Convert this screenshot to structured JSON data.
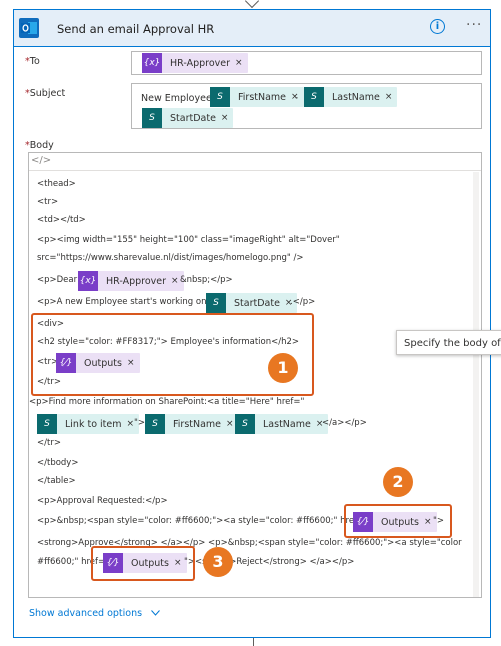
{
  "header": {
    "title": "Send an email Approval HR",
    "info_icon": "info-icon",
    "more_icon": "more-icon",
    "more_glyph": "···",
    "info_glyph": "i"
  },
  "fields": {
    "to_label": "To",
    "subject_label": "Subject",
    "body_label": "Body",
    "required_mark": "*"
  },
  "tokens": {
    "hr_approver": "HR-Approver",
    "first_name": "FirstName",
    "last_name": "LastName",
    "start_date": "StartDate",
    "link_to_item": "Link to item",
    "outputs": "Outputs",
    "remove": "×",
    "expr_icon": "{x}",
    "outputs_icon": "{⁄}"
  },
  "subject_text": {
    "prefix": "New Employee",
    "dash": "-"
  },
  "body": {
    "code_toggle": "</>",
    "lines": {
      "l1": "<thead>",
      "l2": "<tr>",
      "l3": "<td></td>",
      "l4": "<p><img width=\"155\" height=\"100\" class=\"imageRight\" alt=\"Dover\"",
      "l5": "src=\"https://www.sharevalue.nl/dist/images/homelogo.png\" />",
      "l6a": "<p>Dear",
      "l6b": "&nbsp;</p>",
      "l7a": "<p>A new Employee start's working on",
      "l7b": ".</p>",
      "l8": "<div>",
      "l9": "<h2 style=\"color: #FF8317;\"> Employee's information</h2>",
      "l10": "<tr>",
      "l11": "</tr>",
      "l12": "<p>Find more information on SharePoint:<a title=\"Here\" href=\"",
      "l13a": "\">",
      "l13b": "</a></p>",
      "l14": "</tr>",
      "l15": "</tbody>",
      "l16": "</table>",
      "l17": "<p>Approval Requested:</p>",
      "l18a": "<p>&nbsp;<span style=\"color: #ff6600;\"><a style=\"color: #ff6600;\" href=\"",
      "l18b": "\">",
      "l19": "<strong>Approve</strong> </a></p> <p>&nbsp;<span style=\"color: #ff6600;\"><a style=\"color:",
      "l20a": "#ff6600;\" href=\"",
      "l20b": "\"><strong>Reject</strong> </a></p>"
    }
  },
  "tooltip": "Specify the body of the mail",
  "callouts": [
    "1",
    "2",
    "3"
  ],
  "advanced_options": "Show advanced options",
  "colors": {
    "accent": "#0078d4",
    "callout": "#e87722",
    "token_purple": "#7a3ec8",
    "token_teal": "#0b6a6e"
  }
}
